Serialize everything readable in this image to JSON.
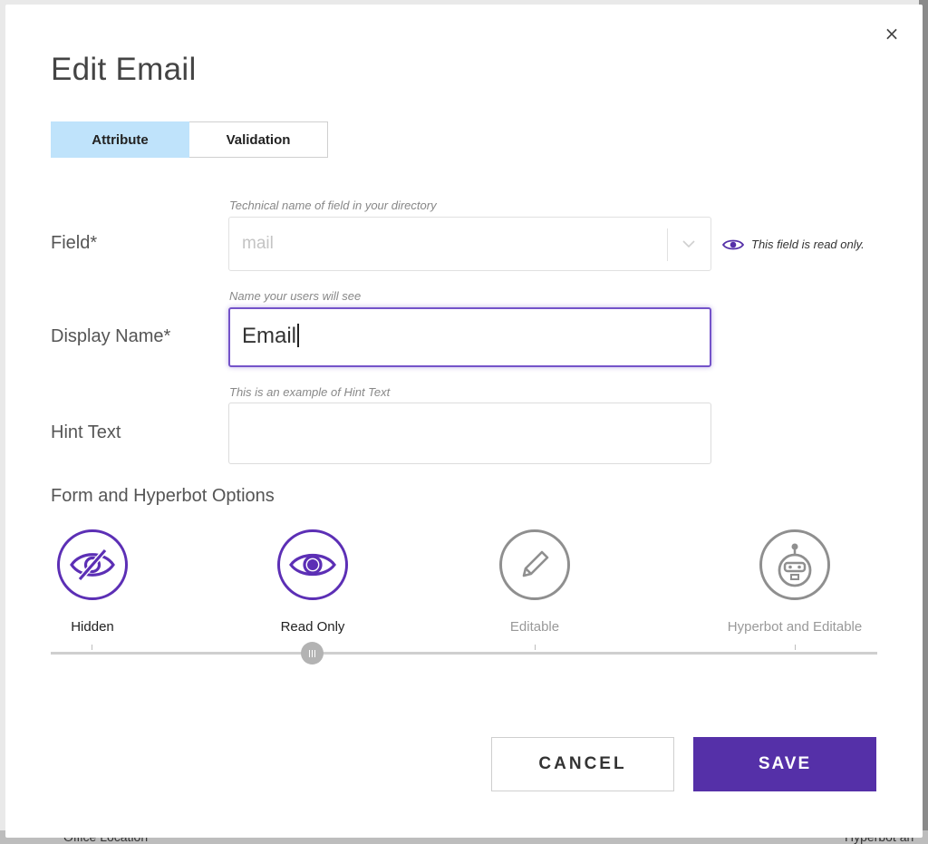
{
  "background": {
    "bottom_left_text": "Office Location",
    "bottom_right_text": "Hyperbot an"
  },
  "dialog": {
    "title": "Edit Email",
    "close_icon": "close-icon",
    "close_glyph": "×"
  },
  "tabs": [
    {
      "label": "Attribute",
      "active": true
    },
    {
      "label": "Validation",
      "active": false
    }
  ],
  "fields": {
    "field": {
      "label": "Field*",
      "hint": "Technical name of field in your directory",
      "value": "mail",
      "readonly_note": "This field is read only."
    },
    "display_name": {
      "label": "Display Name*",
      "hint": "Name your users will see",
      "value": "Email"
    },
    "hint_text": {
      "label": "Hint Text",
      "hint": "This is an example of Hint Text",
      "value": ""
    }
  },
  "options": {
    "title": "Form and Hyperbot Options",
    "items": [
      {
        "label": "Hidden",
        "icon": "eye-slash-icon",
        "active": true
      },
      {
        "label": "Read Only",
        "icon": "eye-icon",
        "active": true
      },
      {
        "label": "Editable",
        "icon": "pencil-icon",
        "active": false
      },
      {
        "label": "Hyperbot and Editable",
        "icon": "robot-icon",
        "active": false
      }
    ],
    "selected_index": 1
  },
  "buttons": {
    "cancel": "CANCEL",
    "save": "SAVE"
  },
  "colors": {
    "accent": "#5530a8",
    "tab_active": "#bfe3fb",
    "focus_border": "#7453c9",
    "inactive_icon": "#8f8f8f"
  }
}
